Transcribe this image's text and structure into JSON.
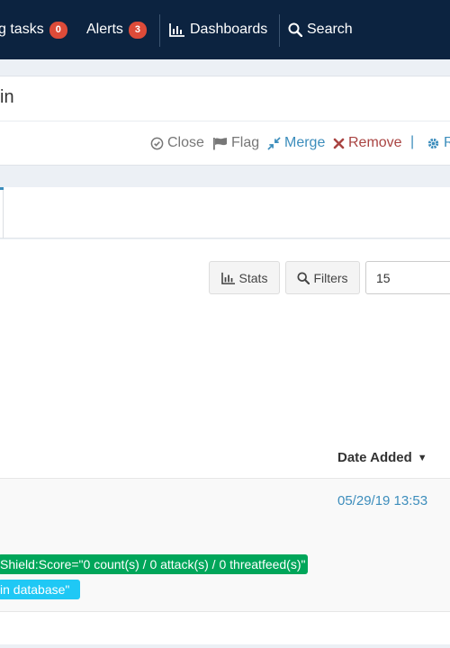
{
  "topbar": {
    "tasks_label": "g tasks",
    "tasks_count": "0",
    "alerts_label": "Alerts",
    "alerts_count": "3",
    "dashboards_label": "Dashboards",
    "search_label": "Search"
  },
  "page": {
    "title": "in"
  },
  "actions": {
    "close_label": "Close",
    "flag_label": "Flag",
    "merge_label": "Merge",
    "remove_label": "Remove",
    "separator": "|",
    "r_label": "R"
  },
  "toolbar": {
    "stats_label": "Stats",
    "filters_label": "Filters",
    "page_size": "15"
  },
  "table": {
    "columns": [
      {
        "label": "Date Added",
        "sort": "desc"
      }
    ],
    "rows": [
      {
        "date_added": "05/29/19 13:53",
        "tags": [
          {
            "text": "Shield:Score=\"0 count(s) / 0 attack(s) / 0 threatfeed(s)\"",
            "color": "#00a65a"
          },
          {
            "text": "in database\"",
            "color": "#1fc8f5"
          }
        ]
      }
    ]
  },
  "colors": {
    "navbar": "#0c2340",
    "badge": "#dd4b39",
    "link": "#3c8dbc",
    "danger": "#a94442"
  }
}
